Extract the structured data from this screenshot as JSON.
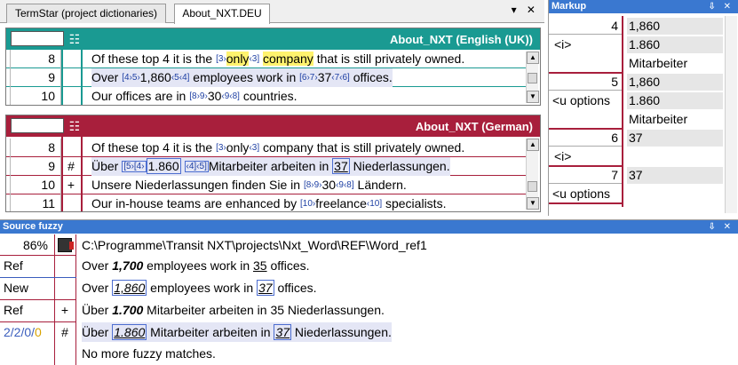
{
  "tabs": [
    {
      "label": "TermStar (project dictionaries)"
    },
    {
      "label": "About_NXT.DEU"
    }
  ],
  "tab_controls": "▾ ✕",
  "english_pane": {
    "title": "About_NXT (English (UK))",
    "rows": [
      {
        "num": "8",
        "mark": "",
        "parts": [
          "Of these top 4 it is the ",
          "[3›",
          "only",
          "‹3]",
          " ",
          "company",
          " that is still privately owned."
        ]
      },
      {
        "num": "9",
        "mark": "",
        "parts": [
          "Over ",
          "[4›5›",
          "1,860",
          "‹5‹4]",
          " employees work in ",
          "[6›7›",
          "37",
          "‹7‹6]",
          " offices."
        ]
      },
      {
        "num": "10",
        "mark": "",
        "parts": [
          "Our offices are in ",
          "[8›9›",
          "30",
          "‹9‹8]",
          " countries."
        ]
      }
    ]
  },
  "german_pane": {
    "title": "About_NXT (German)",
    "rows": [
      {
        "num": "8",
        "mark": "",
        "parts": [
          "Of these top 4 it is the ",
          "[3›",
          "only",
          "‹3]",
          " company that is still privately owned."
        ]
      },
      {
        "num": "9",
        "mark": "#",
        "parts": [
          "Über ",
          "[5›[4›",
          "1.860",
          " ",
          "‹4]‹5]",
          "Mitarbeiter arbeiten in ",
          "37",
          " Niederlassungen."
        ]
      },
      {
        "num": "10",
        "mark": "+",
        "parts": [
          "Unsere Niederlassungen finden Sie in ",
          "[8›9›",
          "30",
          "‹9‹8]",
          " Ländern."
        ]
      },
      {
        "num": "11",
        "mark": "",
        "parts": [
          "Our in-house teams are enhanced by ",
          "[10›",
          "freelance",
          "‹10]",
          " specialists."
        ]
      }
    ]
  },
  "markup_panel": {
    "title": "Markup",
    "controls": "⇩ ✕",
    "entries": [
      {
        "num": "4",
        "label": "<i>",
        "values": [
          "1,860",
          "1.860",
          "Mitarbeiter"
        ]
      },
      {
        "num": "5",
        "label": "<u options",
        "values": [
          "1,860",
          "1.860",
          "Mitarbeiter"
        ]
      },
      {
        "num": "6",
        "label": "<i>",
        "values": [
          "37",
          ""
        ]
      },
      {
        "num": "7",
        "label": "<u options",
        "values": [
          "37",
          ""
        ]
      }
    ]
  },
  "fuzzy_panel": {
    "title": "Source fuzzy",
    "controls": "⇩ ✕",
    "path": "C:\\Programme\\Transit NXT\\projects\\Nxt_Word\\REF\\Word_ref1",
    "score": "86%",
    "rows": [
      {
        "label": "Ref",
        "mark": "",
        "parts": [
          "Over ",
          "1,700",
          " employees work in ",
          "35",
          " offices."
        ]
      },
      {
        "label": "New",
        "mark": "",
        "parts": [
          "Over ",
          "1,860",
          " employees work in ",
          "37",
          " offices."
        ]
      },
      {
        "label": "Ref",
        "mark": "+",
        "parts": [
          "Über ",
          "1.700",
          " Mitarbeiter arbeiten in 35 Niederlassungen."
        ]
      },
      {
        "label_parts": [
          "2/2/0/",
          "0"
        ],
        "mark": "#",
        "parts": [
          "Über ",
          "1.860",
          " Mitarbeiter arbeiten in ",
          "37",
          " Niederlassungen."
        ]
      }
    ],
    "no_more": "No more fuzzy matches."
  },
  "colors": {
    "english_header": "#1a9a92",
    "german_header": "#a81f3c",
    "panel_header": "#3a78d0",
    "highlight": "#fff36e"
  }
}
